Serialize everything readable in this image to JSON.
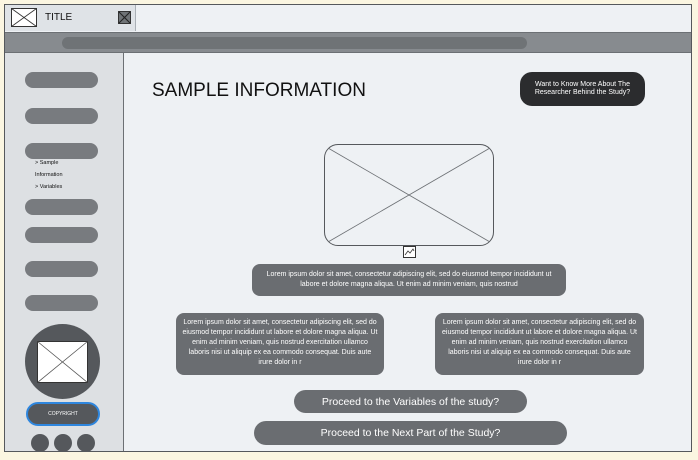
{
  "tab": {
    "title": "TITLE"
  },
  "sidebar": {
    "nav_lines": [
      "> Sample",
      "Information",
      "> Variables"
    ],
    "copyright": "COPYRIGHT"
  },
  "main": {
    "title": "SAMPLE INFORMATION",
    "researcher_button": "Want to Know More About The Researcher Behind the Study?",
    "caption": "Lorem ipsum dolor sit amet, consectetur adipiscing elit, sed do eiusmod tempor incididunt ut labore et dolore magna aliqua. Ut enim ad minim veniam, quis nostrud",
    "left_text": "Lorem ipsum dolor sit amet, consectetur adipiscing elit, sed do eiusmod tempor incididunt ut labore et dolore magna aliqua. Ut enim ad minim veniam, quis nostrud exercitation ullamco laboris nisi ut aliquip ex ea commodo consequat. Duis aute irure dolor in r",
    "right_text": "Lorem ipsum dolor sit amet, consectetur adipiscing elit, sed do eiusmod tempor incididunt ut labore et dolore magna aliqua. Ut enim ad minim veniam, quis nostrud exercitation ullamco laboris nisi ut aliquip ex ea commodo consequat. Duis aute irure dolor in r",
    "proceed_variables": "Proceed to the Variables of the study?",
    "proceed_next": "Proceed to the Next Part of the Study?"
  },
  "colors": {
    "background": "#fbf6e1",
    "dark_button": "#2b2c2e",
    "highlight": "#2e86de"
  }
}
